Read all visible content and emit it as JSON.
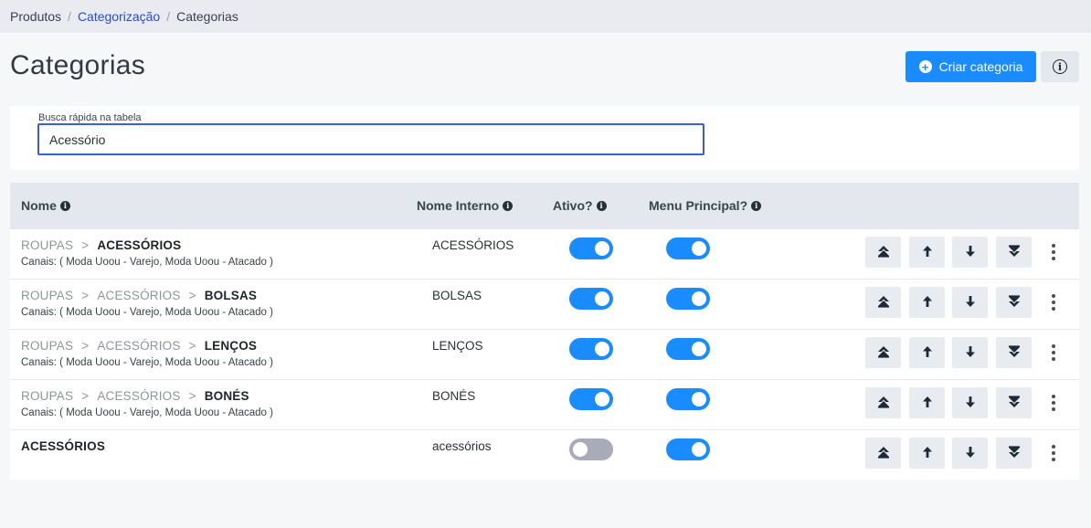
{
  "breadcrumb": {
    "items": [
      {
        "label": "Produtos"
      },
      {
        "label": "Categorização"
      },
      {
        "label": "Categorias"
      }
    ],
    "separator": "/"
  },
  "header": {
    "title": "Categorias",
    "create_label": "Criar categoria",
    "create_icon": "plus-circle-icon",
    "info_icon": "info-icon"
  },
  "search": {
    "label": "Busca rápida na tabela",
    "value": "Acessório"
  },
  "table": {
    "columns": {
      "name": "Nome",
      "internal": "Nome Interno",
      "active": "Ativo?",
      "menu": "Menu Principal?"
    },
    "path_separator": ">",
    "rows": [
      {
        "path": [
          "ROUPAS"
        ],
        "leaf": "ACESSÓRIOS",
        "channels": "Canais: ( Moda Uoou - Varejo, Moda Uoou - Atacado )",
        "internal": "ACESSÓRIOS",
        "active": true,
        "menu": true
      },
      {
        "path": [
          "ROUPAS",
          "ACESSÓRIOS"
        ],
        "leaf": "BOLSAS",
        "channels": "Canais: ( Moda Uoou - Varejo, Moda Uoou - Atacado )",
        "internal": "BOLSAS",
        "active": true,
        "menu": true
      },
      {
        "path": [
          "ROUPAS",
          "ACESSÓRIOS"
        ],
        "leaf": "LENÇOS",
        "channels": "Canais: ( Moda Uoou - Varejo, Moda Uoou - Atacado )",
        "internal": "LENÇOS",
        "active": true,
        "menu": true
      },
      {
        "path": [
          "ROUPAS",
          "ACESSÓRIOS"
        ],
        "leaf": "BONÉS",
        "channels": "Canais: ( Moda Uoou - Varejo, Moda Uoou - Atacado )",
        "internal": "BONÉS",
        "active": true,
        "menu": true
      },
      {
        "path": [],
        "leaf": "ACESSÓRIOS",
        "channels": "",
        "internal": "acessórios",
        "active": false,
        "menu": true
      }
    ]
  },
  "colors": {
    "accent": "#1a8cff",
    "toggle_off": "#a9abb8",
    "link": "#2b4cc7"
  }
}
